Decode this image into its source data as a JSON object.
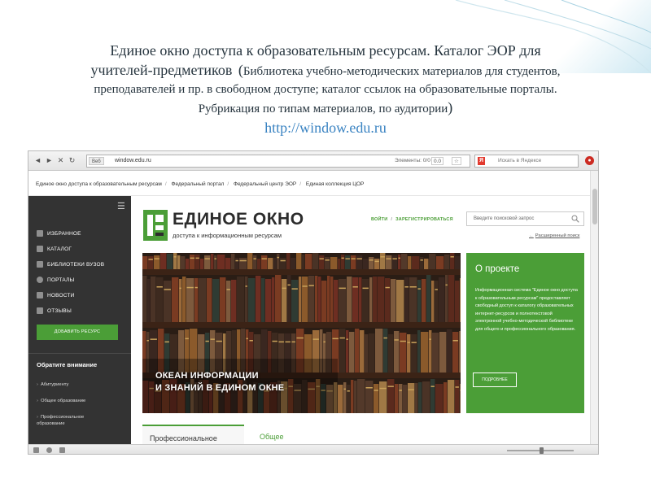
{
  "slide": {
    "title_line1": "Единое окно доступа к образовательным ресурсам. Каталог ЭОР для",
    "title_line2_start": "учителей-предметиков",
    "title_paren_open": "(",
    "title_line2_rest": "Библиотека учебно-методических материалов для студентов,",
    "title_line3": "преподавателей и пр. в свободном доступе; каталог ссылок на образовательные порталы.",
    "title_line4": "Рубрикация по типам материалов, по аудитории",
    "title_paren_close": ")",
    "url": "http://window.edu.ru"
  },
  "browser": {
    "proto_label": "Веб",
    "address": "window.edu.ru",
    "elements_label": "Элементы: 0/0",
    "counter1": "0.0",
    "counter2": "☆",
    "search_placeholder": "Искать в Яндексе",
    "yandex_glyph": "Я"
  },
  "breadcrumbs": [
    "Единое окно доступа к образовательным ресурсам",
    "Федеральный портал",
    "Федеральный центр ЭОР",
    "Единая коллекция ЦОР"
  ],
  "breadcrumb_sep": "/",
  "sidebar": {
    "menu_glyph": "☰",
    "items": [
      {
        "label": "ИЗБРАННОЕ"
      },
      {
        "label": "КАТАЛОГ"
      },
      {
        "label": "БИБЛИОТЕКИ ВУЗОВ"
      },
      {
        "label": "ПОРТАЛЫ"
      },
      {
        "label": "НОВОСТИ"
      },
      {
        "label": "ОТЗЫВЫ"
      }
    ],
    "add_button": "ДОБАВИТЬ РЕСУРС",
    "attention_heading": "Обратите внимание",
    "links": [
      "Абитуриенту",
      "Общее образование",
      "Профессиональное образование"
    ],
    "link_arrow": "›"
  },
  "header": {
    "logo_title": "ЕДИНОЕ ОКНО",
    "logo_subtitle": "доступа к информационным ресурсам",
    "login": "ВОЙТИ",
    "auth_sep": "/",
    "register": "ЗАРЕГИСТРИРОВАТЬСЯ",
    "search_placeholder": "Введите поисковой запрос",
    "advanced_search": "Расширенный поиск",
    "advanced_arrow": "←"
  },
  "hero": {
    "caption_line1": "ОКЕАН ИНФОРМАЦИИ",
    "caption_line2": "И ЗНАНИЙ В ЕДИНОМ ОКНЕ"
  },
  "about": {
    "heading": "О проекте",
    "text": "Информационная система \"Единое окно доступа к образовательным ресурсам\" предоставляет свободный доступ к каталогу образовательных интернет-ресурсов и полнотекстовой электронной учебно-методической библиотеке для общего и профессионального образования.",
    "button": "ПОДРОБНЕЕ"
  },
  "tabs": [
    {
      "label": "Профессиональное",
      "active": true
    },
    {
      "label": "Общее",
      "active": false
    }
  ],
  "colors": {
    "brand_green": "#4b9e37",
    "sidebar_bg": "#333333",
    "slide_url": "#3a83c2"
  }
}
